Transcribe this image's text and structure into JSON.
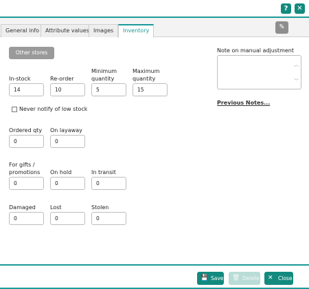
{
  "header": {
    "help_icon": "question-icon",
    "close_icon": "close-icon",
    "help_glyph": "?",
    "close_glyph": "✕"
  },
  "tabs": [
    {
      "label": "General info",
      "active": false
    },
    {
      "label": "Attribute values",
      "active": false
    },
    {
      "label": "Images",
      "active": false
    },
    {
      "label": "Inventory",
      "active": true
    }
  ],
  "toolbar": {
    "edit_icon": "pencil-icon",
    "edit_glyph": "✎"
  },
  "stores_button": "Other stores",
  "fields": {
    "in_stock": {
      "label": "In-stock",
      "value": "14"
    },
    "reorder": {
      "label": "Re-order",
      "value": "10"
    },
    "min_qty": {
      "label_line1": "Minimum",
      "label_line2": "quantity",
      "value": "5"
    },
    "max_qty": {
      "label_line1": "Maximum",
      "label_line2": "quantity",
      "value": "15"
    },
    "ordered_qty": {
      "label": "Ordered qty",
      "value": "0"
    },
    "on_layaway": {
      "label": "On layaway",
      "value": "0"
    },
    "for_gifts": {
      "label_line1": "For gifts /",
      "label_line2": "promotions",
      "value": "0"
    },
    "on_hold": {
      "label": "On hold",
      "value": "0"
    },
    "in_transit": {
      "label": "In transit",
      "value": "0"
    },
    "damaged": {
      "label": "Damaged",
      "value": "0"
    },
    "lost": {
      "label": "Lost",
      "value": "0"
    },
    "stolen": {
      "label": "Stolen",
      "value": "0"
    }
  },
  "never_notify": {
    "label": "Never notify of low stock",
    "checked": false
  },
  "note": {
    "label": "Note on manual adjustment",
    "value": "",
    "previous_notes": "Previous Notes..."
  },
  "footer": {
    "save": {
      "label": "Save",
      "icon": "floppy-icon",
      "glyph": "💾"
    },
    "delete": {
      "label": "Delete",
      "icon": "trash-icon",
      "glyph": "🗑"
    },
    "close": {
      "label": "Close",
      "icon": "x-icon",
      "glyph": "✕"
    }
  },
  "colors": {
    "accent": "#138a7e",
    "accent_line": "#1a9a97",
    "disabled": "#b9dcd6"
  }
}
